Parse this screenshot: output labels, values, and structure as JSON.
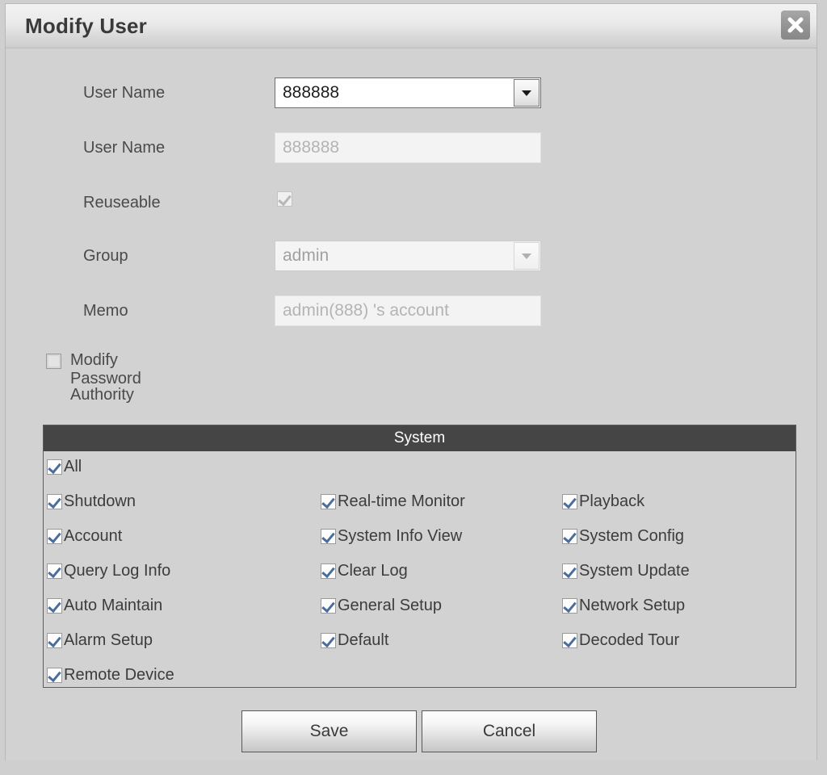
{
  "dialog": {
    "title": "Modify User",
    "close_icon": "close-icon"
  },
  "form": {
    "username_select": {
      "label": "User Name",
      "value": "888888",
      "arrow_icon": "chevron-down-icon"
    },
    "username_text": {
      "label": "User Name",
      "value": "888888"
    },
    "reuseable": {
      "label": "Reuseable",
      "checked": true
    },
    "group": {
      "label": "Group",
      "value": "admin",
      "arrow_icon": "chevron-down-icon"
    },
    "memo": {
      "label": "Memo",
      "value": "admin(888) 's account"
    },
    "modify_password": {
      "label": "Modify Password",
      "checked": false
    },
    "authority_label": "Authority"
  },
  "authority": {
    "header": "System",
    "all": {
      "label": "All",
      "checked": true
    },
    "permissions": [
      {
        "label": "Shutdown",
        "checked": true
      },
      {
        "label": "Real-time Monitor",
        "checked": true
      },
      {
        "label": "Playback",
        "checked": true
      },
      {
        "label": "Account",
        "checked": true
      },
      {
        "label": "System Info View",
        "checked": true
      },
      {
        "label": "System Config",
        "checked": true
      },
      {
        "label": "Query Log Info",
        "checked": true
      },
      {
        "label": "Clear Log",
        "checked": true
      },
      {
        "label": "System Update",
        "checked": true
      },
      {
        "label": "Auto Maintain",
        "checked": true
      },
      {
        "label": "General Setup",
        "checked": true
      },
      {
        "label": "Network Setup",
        "checked": true
      },
      {
        "label": "Alarm Setup",
        "checked": true
      },
      {
        "label": "Default",
        "checked": true
      },
      {
        "label": "Decoded Tour",
        "checked": true
      },
      {
        "label": "Remote Device",
        "checked": true
      }
    ]
  },
  "footer": {
    "save_label": "Save",
    "cancel_label": "Cancel"
  },
  "colors": {
    "dialog_bg": "#d2d2d2",
    "header_bar": "#454545",
    "check_mark": "#4a6d9c",
    "title_text": "#3a3a3a"
  }
}
